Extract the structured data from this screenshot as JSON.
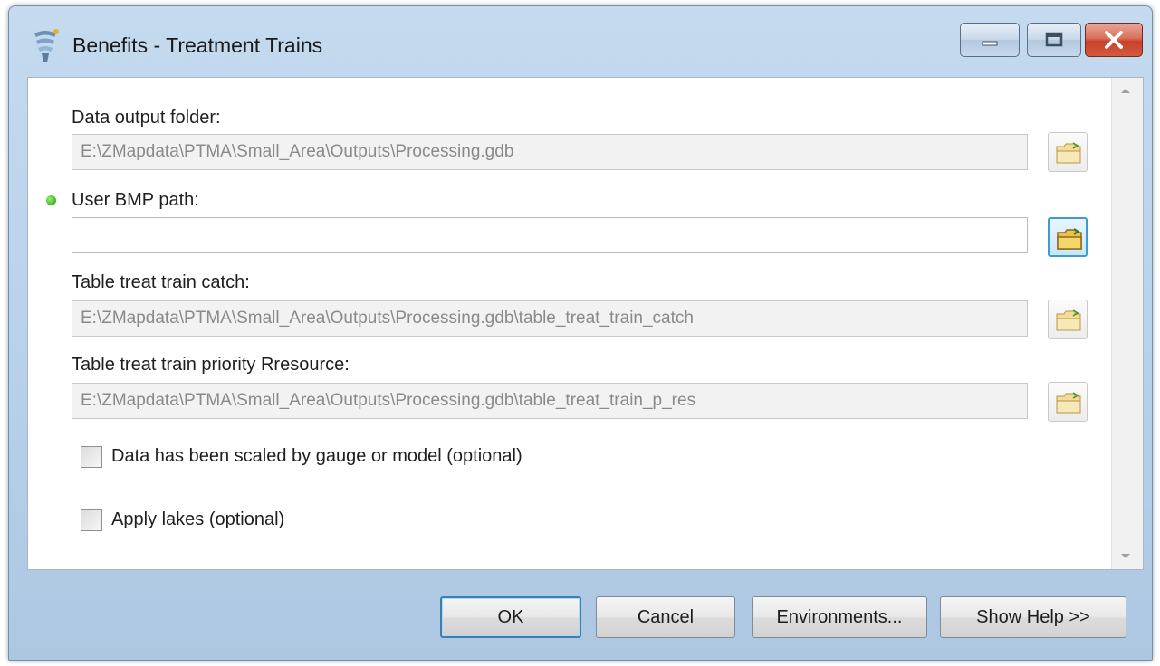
{
  "window": {
    "title": "Benefits - Treatment Trains"
  },
  "fields": [
    {
      "label": "Data output folder:",
      "value": "E:\\ZMapdata\\PTMA\\Small_Area\\Outputs\\Processing.gdb",
      "required": false
    },
    {
      "label": "User BMP path:",
      "value": "",
      "required": true
    },
    {
      "label": "Table treat train catch:",
      "value": "E:\\ZMapdata\\PTMA\\Small_Area\\Outputs\\Processing.gdb\\table_treat_train_catch",
      "required": false
    },
    {
      "label": "Table treat train priority Rresource:",
      "value": "E:\\ZMapdata\\PTMA\\Small_Area\\Outputs\\Processing.gdb\\table_treat_train_p_res",
      "required": false
    }
  ],
  "options": [
    {
      "label": "Data has been scaled by gauge or model (optional)",
      "checked": false
    },
    {
      "label": "Apply lakes (optional)",
      "checked": false
    }
  ],
  "buttons": {
    "ok": "OK",
    "cancel": "Cancel",
    "environments": "Environments...",
    "help": "Show Help >>"
  },
  "colors": {
    "frame": "#b7d0ea",
    "required_indicator": "#2fb81f",
    "close_button": "#c8412a",
    "default_button_border": "#3c7fb1"
  },
  "icons": [
    "app-tool-icon",
    "minimize-icon",
    "maximize-icon",
    "close-icon",
    "folder-icon",
    "required-dot-icon"
  ]
}
